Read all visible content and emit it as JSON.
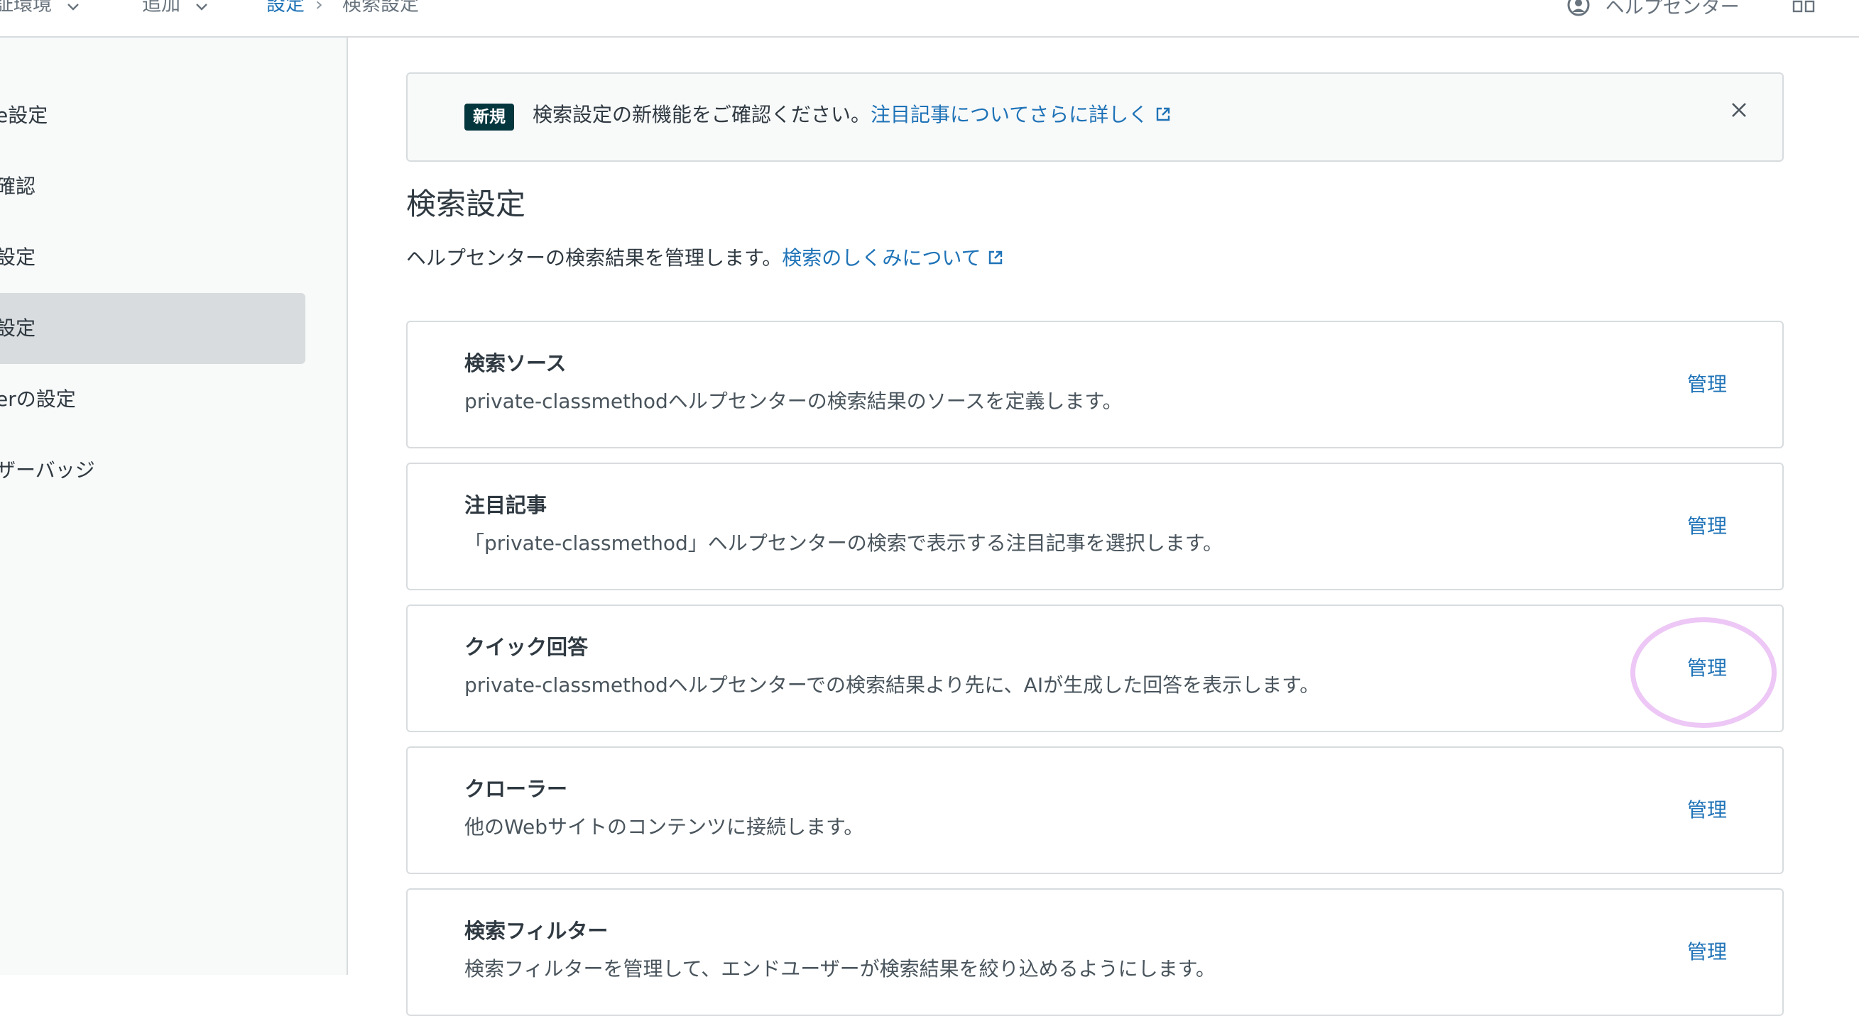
{
  "topbar": {
    "env_label": "証環境",
    "add_label": "追加",
    "help_label": "ヘルプセンター"
  },
  "breadcrumb": {
    "parent": "設定",
    "separator": "›",
    "current": "検索設定"
  },
  "sidebar": {
    "items": [
      {
        "label": "e設定",
        "active": false
      },
      {
        "label": "確認",
        "active": false
      },
      {
        "label": "設定",
        "active": false
      },
      {
        "label": "設定",
        "active": true
      },
      {
        "label": "erの設定",
        "active": false
      },
      {
        "label": "ザーバッジ",
        "active": false
      }
    ]
  },
  "banner": {
    "badge": "新規",
    "text": "検索設定の新機能をご確認ください。",
    "link": "注目記事についてさらに詳しく"
  },
  "page": {
    "title": "検索設定",
    "description": "ヘルプセンターの検索結果を管理します。",
    "description_link": "検索のしくみについて"
  },
  "cards": [
    {
      "title": "検索ソース",
      "description": "private-classmethodヘルプセンターの検索結果のソースを定義します。",
      "action": "管理"
    },
    {
      "title": "注目記事",
      "description": "「private-classmethod」ヘルプセンターの検索で表示する注目記事を選択します。",
      "action": "管理"
    },
    {
      "title": "クイック回答",
      "description": "private-classmethodヘルプセンターでの検索結果より先に、AIが生成した回答を表示します。",
      "action": "管理"
    },
    {
      "title": "クローラー",
      "description": "他のWebサイトのコンテンツに接続します。",
      "action": "管理"
    },
    {
      "title": "検索フィルター",
      "description": "検索フィルターを管理して、エンドユーザーが検索結果を絞り込めるようにします。",
      "action": "管理"
    }
  ],
  "colors": {
    "link": "#1f73b7",
    "badge_bg": "#03363d",
    "highlight": "#edc7f5",
    "border": "#d8dcde"
  }
}
